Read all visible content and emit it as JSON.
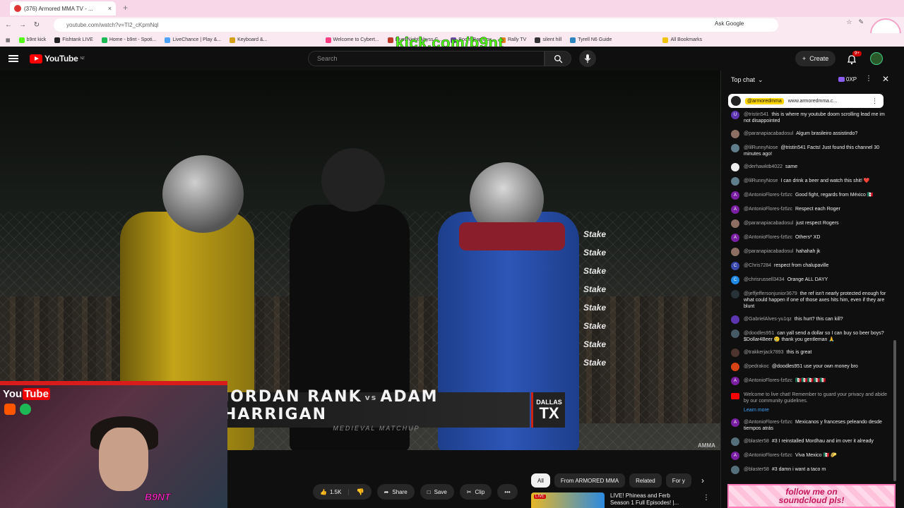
{
  "browser": {
    "tab_title": "(376) Armored MMA TV - ...",
    "tab_close": "×",
    "new_tab": "+",
    "url": "youtube.com/watch?v=TI2_cKpmNql",
    "ask_google": "Ask Google",
    "bookmarks": [
      {
        "label": "b9nt kick",
        "color": "#53fc18"
      },
      {
        "label": "Fishtank LIVE",
        "color": "#222222"
      },
      {
        "label": "Home - b9nt - Spoti...",
        "color": "#1db954"
      },
      {
        "label": "LiveChance | Play &...",
        "color": "#4aa3ff"
      },
      {
        "label": "Keyboard &...",
        "color": "#d4a017"
      },
      {
        "label": "Welcome to Cybert...",
        "color": "#ff3d7f"
      },
      {
        "label": "Duet Night Abyss C...",
        "color": "#c0392b"
      },
      {
        "label": "Boom Bap Box",
        "color": "#6b4ba1"
      },
      {
        "label": "Rally TV",
        "color": "#e67e22"
      },
      {
        "label": "silent hill",
        "color": "#333333"
      },
      {
        "label": "Tyrell N6 Guide",
        "color": "#2e86c1"
      },
      {
        "label": "All Bookmarks",
        "color": "#f1c40f"
      }
    ]
  },
  "overlay": {
    "kick_text": "kick.com/b9nt",
    "cam_brand_you": "You",
    "cam_brand_tube": "Tube",
    "cam_tag": "B9NT",
    "soundcloud_line1": "follow me on",
    "soundcloud_line2": "soundcloud pls!"
  },
  "masthead": {
    "logo": "YouTube",
    "logo_sup": "NZ",
    "search_placeholder": "Search",
    "create_label": "Create",
    "notif_badge": "9+"
  },
  "video": {
    "fighter1": "JORDAN RANK",
    "vs": "vs",
    "fighter2": "ADAM HARRIGAN",
    "subtitle": "MEDIEVAL MATCHUP",
    "city": "DALLAS",
    "state": "TX",
    "corner_logo": "AMMA",
    "sponsor": "Stake"
  },
  "actions": {
    "likes": "1.5K",
    "share": "Share",
    "save": "Save",
    "clip": "Clip",
    "more": "•••"
  },
  "chips": [
    "All",
    "From ARMORED MMA",
    "Related",
    "For y"
  ],
  "recommendation": {
    "live": "LIVE",
    "title": "LIVE! Phineas and Ferb Season 1 Full Episodes! |..."
  },
  "chat": {
    "header": "Top chat",
    "xp": "0XP",
    "pinned_author": "@armoredmma",
    "pinned_text": "www.armoredmma.c...",
    "messages": [
      {
        "author": "@tristin541",
        "text": "this is where my youtube doom scrolling lead me im not disappointed",
        "color": "#5e35b1",
        "initial": "U"
      },
      {
        "author": "@paranapiacabadosul",
        "text": "Algum brasileiro assistindo?",
        "color": "#8d6e63",
        "initial": ""
      },
      {
        "author": "@lilRunnyNose",
        "text": "@tristin541 Facts! Just found this channel 30 minutes ago!",
        "color": "#607d8b",
        "initial": ""
      },
      {
        "author": "@derhawktb4022",
        "text": "same",
        "color": "#eeeeee",
        "initial": ""
      },
      {
        "author": "@lilRunnyNose",
        "text": "I can drink a beer and watch this shit! ❤️",
        "color": "#607d8b",
        "initial": ""
      },
      {
        "author": "@AntonioFlores-fz6zc",
        "text": "Good fight, regards from México 🇲🇽",
        "color": "#7b1fa2",
        "initial": "A"
      },
      {
        "author": "@AntonioFlores-fz6zc",
        "text": "Respect each Roger",
        "color": "#7b1fa2",
        "initial": "A"
      },
      {
        "author": "@paranapiacabadosul",
        "text": "just respect Rogers",
        "color": "#8d6e63",
        "initial": ""
      },
      {
        "author": "@AntonioFlores-fz6zc",
        "text": "Others* XD",
        "color": "#7b1fa2",
        "initial": "A"
      },
      {
        "author": "@paranapiacabadosul",
        "text": "hahahah jk",
        "color": "#8d6e63",
        "initial": ""
      },
      {
        "author": "@Chris7284",
        "text": "respect from chalupaville",
        "color": "#3949ab",
        "initial": "C"
      },
      {
        "author": "@chrisrussell3434",
        "text": "Orange ALL DAYY",
        "color": "#1e88e5",
        "initial": "C"
      },
      {
        "author": "@jeffjeffersonjunior3679",
        "text": "the ref isn't nearly protected enough for what could happen if one of those axes hits him, even if they are blunt",
        "color": "#263238",
        "initial": ""
      },
      {
        "author": "@GabrielAlves-yu1qz",
        "text": "this hurt? this can kill?",
        "color": "#5e35b1",
        "initial": ""
      },
      {
        "author": "@doodles951",
        "text": "can yall send a dollar so I can buy so beer boys? $Dollar4Beer 🥲 thank you gentleman 🙏",
        "color": "#455a64",
        "initial": ""
      },
      {
        "author": "@trakkerjack7893",
        "text": "this is great",
        "color": "#4e342e",
        "initial": ""
      },
      {
        "author": "@pedrakoc",
        "text": "@doodles951 use your own money bro",
        "color": "#d84315",
        "initial": ""
      },
      {
        "author": "@AntonioFlores-fz6zc",
        "text": "🇲🇽🇲🇽🇲🇽🇲🇽🇲🇽",
        "color": "#7b1fa2",
        "initial": "A"
      }
    ],
    "welcome_text": "Welcome to live chat! Remember to guard your privacy and abide by our community guidelines.",
    "learn_more": "Learn more",
    "messages2": [
      {
        "author": "@AntonioFlores-fz6zc",
        "text": "Mexicanos y franceses peleando desde tiempos atrás",
        "color": "#7b1fa2",
        "initial": "A"
      },
      {
        "author": "@blaster58",
        "text": "#3 I reinstalled Mordhau and im over it already",
        "color": "#546e7a",
        "initial": ""
      },
      {
        "author": "@AntonioFlores-fz6zc",
        "text": "Viva Mexico 🇲🇽 🌮",
        "color": "#7b1fa2",
        "initial": "A"
      },
      {
        "author": "@blaster58",
        "text": "#3 damn i want a taco rn",
        "color": "#546e7a",
        "initial": ""
      }
    ]
  }
}
